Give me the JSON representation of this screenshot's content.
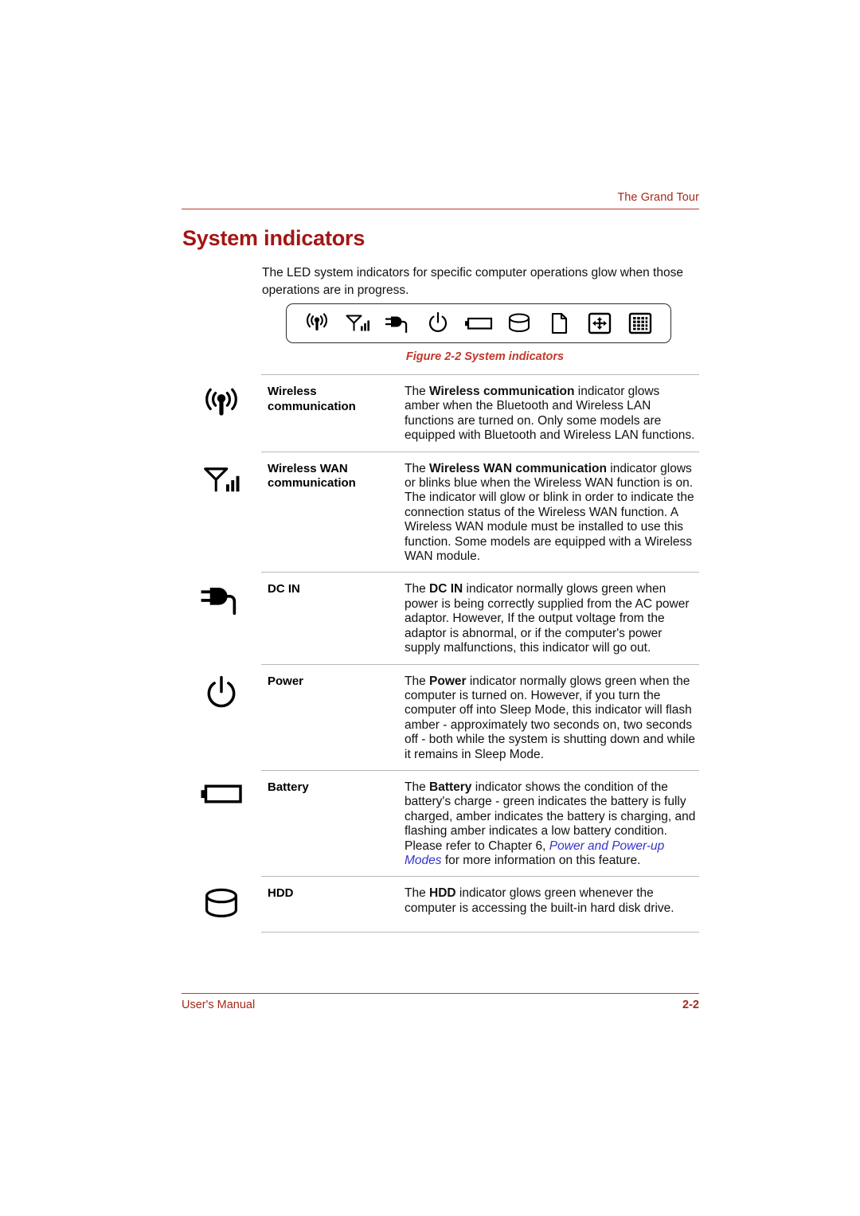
{
  "header": {
    "title": "The Grand Tour"
  },
  "heading": "System indicators",
  "intro": "The LED system indicators for specific computer operations glow when those operations are in progress.",
  "figure": {
    "caption": "Figure 2-2 System indicators",
    "icons": [
      "wireless-communication-icon",
      "wireless-wan-icon",
      "dc-in-plug-icon",
      "power-icon",
      "battery-icon",
      "hdd-icon",
      "media-card-icon",
      "touchpad-icon",
      "keypad-icon"
    ]
  },
  "indicators": [
    {
      "icon": "wireless-communication-icon",
      "name": "Wireless communication",
      "desc_lead": "The ",
      "desc_bold": "Wireless communication",
      "desc_rest": " indicator glows amber when the Bluetooth and Wireless LAN functions are turned on. Only some models are equipped with Bluetooth and Wireless LAN functions."
    },
    {
      "icon": "wireless-wan-icon",
      "name": "Wireless WAN communication",
      "desc_lead": "The ",
      "desc_bold": "Wireless WAN communication",
      "desc_rest": " indicator glows or blinks blue when the Wireless WAN function is on. The indicator will glow or blink in order to indicate the connection status of the Wireless WAN function. A Wireless WAN module must be installed to use this function. Some models are equipped with a Wireless WAN module."
    },
    {
      "icon": "dc-in-plug-icon",
      "name": "DC IN",
      "desc_lead": "The ",
      "desc_bold": "DC IN",
      "desc_rest": " indicator normally glows green when power is being correctly supplied from the AC power adaptor. However, If the output voltage from the adaptor is abnormal, or if the computer's power supply malfunctions, this indicator will go out."
    },
    {
      "icon": "power-icon",
      "name": "Power",
      "desc_lead": "The ",
      "desc_bold": "Power",
      "desc_rest": " indicator normally glows green when the computer is turned on. However, if you turn the computer off into Sleep Mode, this indicator will flash amber - approximately  two seconds on, two seconds off - both while the system is shutting down and while it remains in Sleep Mode."
    },
    {
      "icon": "battery-icon",
      "name": "Battery",
      "desc_lead": "The ",
      "desc_bold": "Battery",
      "desc_rest": " indicator shows the condition of the battery's charge - green indicates the battery is fully charged, amber indicates the battery is charging, and flashing amber indicates a low battery condition. Please refer to Chapter 6, ",
      "desc_link": "Power and Power-up Modes",
      "desc_tail": " for more information on this feature."
    },
    {
      "icon": "hdd-icon",
      "name": "HDD",
      "desc_lead": "The ",
      "desc_bold": "HDD",
      "desc_rest": " indicator glows green whenever the computer is accessing the built-in hard disk drive."
    }
  ],
  "footer": {
    "label": "User's Manual",
    "page": "2-2"
  },
  "colors": {
    "accent_red": "#C0392B",
    "heading_red": "#A31515",
    "link_blue": "#3333CC",
    "rule_gray": "#b8b8b8"
  }
}
